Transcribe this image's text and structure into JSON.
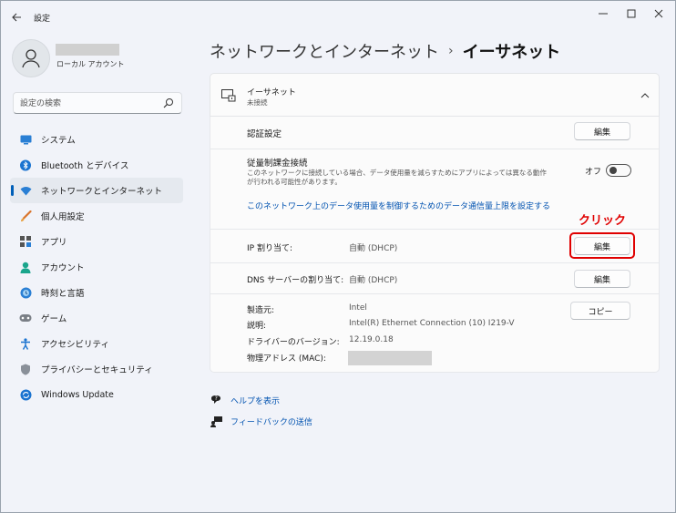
{
  "window": {
    "app_title": "設定",
    "back_icon": "back-arrow-icon",
    "controls": [
      "minimize-icon",
      "maximize-icon",
      "close-icon"
    ]
  },
  "profile": {
    "account_type": "ローカル アカウント"
  },
  "search": {
    "placeholder": "設定の検索",
    "value": ""
  },
  "sidebar": {
    "items": [
      {
        "label": "システム",
        "icon": "system-icon",
        "active": false
      },
      {
        "label": "Bluetooth とデバイス",
        "icon": "bluetooth-icon",
        "active": false
      },
      {
        "label": "ネットワークとインターネット",
        "icon": "network-icon",
        "active": true
      },
      {
        "label": "個人用設定",
        "icon": "personalization-icon",
        "active": false
      },
      {
        "label": "アプリ",
        "icon": "apps-icon",
        "active": false
      },
      {
        "label": "アカウント",
        "icon": "account-icon",
        "active": false
      },
      {
        "label": "時刻と言語",
        "icon": "time-language-icon",
        "active": false
      },
      {
        "label": "ゲーム",
        "icon": "gaming-icon",
        "active": false
      },
      {
        "label": "アクセシビリティ",
        "icon": "accessibility-icon",
        "active": false
      },
      {
        "label": "プライバシーとセキュリティ",
        "icon": "privacy-icon",
        "active": false
      },
      {
        "label": "Windows Update",
        "icon": "windows-update-icon",
        "active": false
      }
    ]
  },
  "breadcrumb": {
    "parent": "ネットワークとインターネット",
    "separator": "›",
    "current": "イーサネット"
  },
  "ethernet": {
    "title": "イーサネット",
    "status": "未接続",
    "auth": {
      "label": "認証設定",
      "button": "編集"
    },
    "metered": {
      "label": "従量制課金接続",
      "desc_line1": "このネットワークに接続している場合、データ使用量を減らすためにアプリによっては異なる動作",
      "desc_line2": "が行われる可能性があります。",
      "toggle_label": "オフ",
      "toggle_on": false
    },
    "data_limit_link": "このネットワーク上のデータ使用量を制御するためのデータ通信量上限を設定する",
    "ip": {
      "label": "IP 割り当て:",
      "value": "自動 (DHCP)",
      "button": "編集"
    },
    "dns": {
      "label": "DNS サーバーの割り当て:",
      "value": "自動 (DHCP)",
      "button": "編集"
    },
    "props": {
      "manufacturer_label": "製造元:",
      "manufacturer": "Intel",
      "description_label": "説明:",
      "description": "Intel(R) Ethernet Connection (10) I219-V",
      "driver_label": "ドライバーのバージョン:",
      "driver": "12.19.0.18",
      "mac_label": "物理アドレス (MAC):",
      "copy_button": "コピー"
    }
  },
  "annotation": {
    "text": "クリック",
    "color": "#e00000"
  },
  "help_links": [
    {
      "label": "ヘルプを表示",
      "icon": "help-icon"
    },
    {
      "label": "フィードバックの送信",
      "icon": "feedback-icon"
    }
  ],
  "colors": {
    "accent": "#005fb8",
    "link": "#0052b0",
    "annotation": "#e00000"
  }
}
